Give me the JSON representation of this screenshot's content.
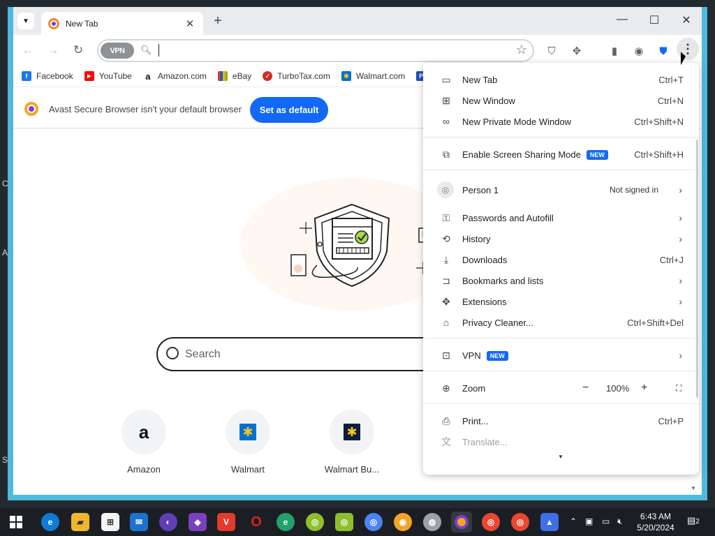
{
  "desktop": {
    "edge_letters": [
      "C",
      "A",
      "S"
    ]
  },
  "tabs": [
    {
      "title": "New Tab"
    }
  ],
  "toolbar": {
    "vpn_label": "VPN",
    "omnibox_value": ""
  },
  "bookmarks": [
    {
      "label": "Facebook",
      "icon": "facebook-icon",
      "color": "#1877f2",
      "glyph": "f"
    },
    {
      "label": "YouTube",
      "icon": "youtube-icon",
      "color": "#ff0000",
      "glyph": "▶"
    },
    {
      "label": "Amazon.com",
      "icon": "amazon-icon",
      "color": "#ffffff",
      "glyph": "a"
    },
    {
      "label": "eBay",
      "icon": "ebay-icon",
      "color": "#e53238",
      "glyph": "e"
    },
    {
      "label": "TurboTax.com",
      "icon": "turbotax-icon",
      "color": "#d52b1e",
      "glyph": "✓"
    },
    {
      "label": "Walmart.com",
      "icon": "walmart-icon",
      "color": "#0071ce",
      "glyph": "✱"
    }
  ],
  "infobar": {
    "message": "Avast Secure Browser isn't your default browser",
    "button": "Set as default"
  },
  "page": {
    "search_placeholder": "Search",
    "tiles": [
      {
        "label": "Amazon",
        "icon": "amazon-icon"
      },
      {
        "label": "Walmart",
        "icon": "walmart-icon"
      },
      {
        "label": "Walmart Bu...",
        "icon": "walmart-business-icon"
      }
    ]
  },
  "menu": {
    "new_tab": {
      "label": "New Tab",
      "shortcut": "Ctrl+T"
    },
    "new_window": {
      "label": "New Window",
      "shortcut": "Ctrl+N"
    },
    "new_private": {
      "label": "New Private Mode Window",
      "shortcut": "Ctrl+Shift+N"
    },
    "screen_sharing": {
      "label": "Enable Screen Sharing Mode",
      "badge": "NEW",
      "shortcut": "Ctrl+Shift+H"
    },
    "person": {
      "label": "Person 1",
      "status": "Not signed in"
    },
    "passwords": {
      "label": "Passwords and Autofill"
    },
    "history": {
      "label": "History"
    },
    "downloads": {
      "label": "Downloads",
      "shortcut": "Ctrl+J"
    },
    "bookmarks": {
      "label": "Bookmarks and lists"
    },
    "extensions": {
      "label": "Extensions"
    },
    "privacy_cleaner": {
      "label": "Privacy Cleaner...",
      "shortcut": "Ctrl+Shift+Del"
    },
    "vpn": {
      "label": "VPN",
      "badge": "NEW"
    },
    "zoom": {
      "label": "Zoom",
      "minus": "−",
      "value": "100%",
      "plus": "+"
    },
    "print": {
      "label": "Print...",
      "shortcut": "Ctrl+P"
    },
    "translate": {
      "label": "Translate..."
    }
  },
  "taskbar": {
    "time": "6:43 AM",
    "date": "5/20/2024",
    "notifications": "2"
  }
}
